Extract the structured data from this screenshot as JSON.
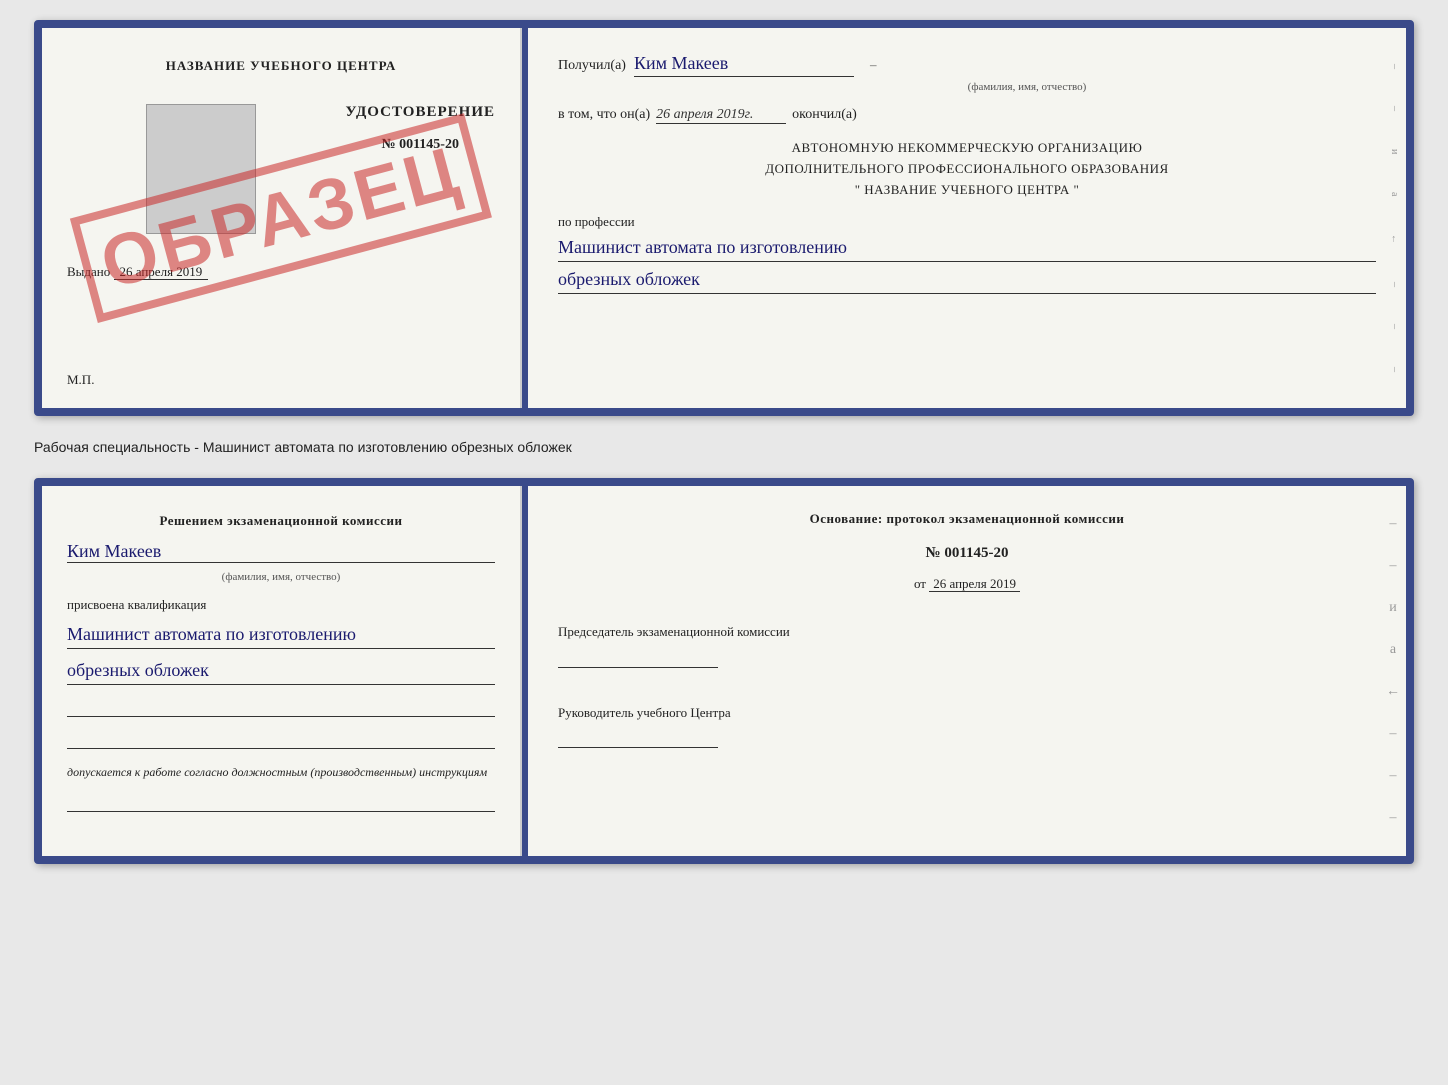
{
  "doc1": {
    "left": {
      "school_name": "НАЗВАНИЕ УЧЕБНОГО ЦЕНТРА",
      "cert_title": "УДОСТОВЕРЕНИЕ",
      "cert_number": "№ 001145-20",
      "issued_label": "Выдано",
      "issued_date": "26 апреля 2019",
      "mp_label": "М.П.",
      "stamp_text": "ОБРАЗЕЦ"
    },
    "right": {
      "recipient_label": "Получил(а)",
      "recipient_name": "Ким Макеев",
      "fio_sub": "(фамилия, имя, отчество)",
      "completion_prefix": "в том, что он(а)",
      "completion_date": "26 апреля 2019г.",
      "completion_suffix": "окончил(а)",
      "org_line1": "АВТОНОМНУЮ НЕКОММЕРЧЕСКУЮ ОРГАНИЗАЦИЮ",
      "org_line2": "ДОПОЛНИТЕЛЬНОГО ПРОФЕССИОНАЛЬНОГО ОБРАЗОВАНИЯ",
      "org_line3": "\"   НАЗВАНИЕ УЧЕБНОГО ЦЕНТРА   \"",
      "profession_label": "по профессии",
      "profession_line1": "Машинист автомата по изготовлению",
      "profession_line2": "обрезных обложек"
    }
  },
  "separator": {
    "text": "Рабочая специальность - Машинист автомата по изготовлению обрезных обложек"
  },
  "doc2": {
    "left": {
      "decision_text": "Решением экзаменационной комиссии",
      "person_name": "Ким Макеев",
      "fio_sub": "(фамилия, имя, отчество)",
      "qualification_label": "присвоена квалификация",
      "qualification_line1": "Машинист автомата по изготовлению",
      "qualification_line2": "обрезных обложек",
      "admission_text": "допускается к  работе согласно должностным (производственным) инструкциям"
    },
    "right": {
      "basis_label": "Основание: протокол экзаменационной комиссии",
      "protocol_number": "№  001145-20",
      "protocol_date_prefix": "от",
      "protocol_date": "26 апреля 2019",
      "chair_title": "Председатель экзаменационной комиссии",
      "head_title": "Руководитель учебного Центра"
    }
  },
  "side_marks": {
    "items": [
      "-",
      "и",
      "а",
      "←",
      "-",
      "-",
      "-",
      "-"
    ]
  }
}
